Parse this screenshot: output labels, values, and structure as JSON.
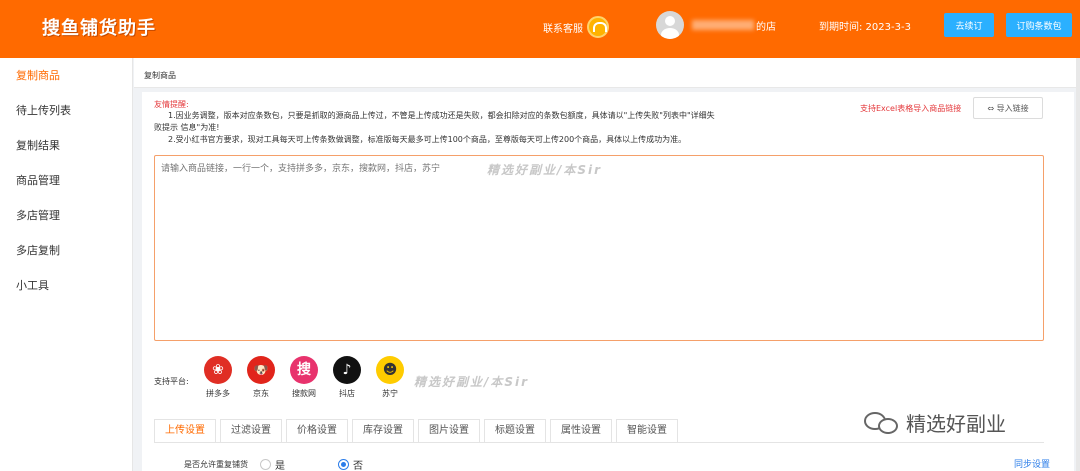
{
  "header": {
    "logo": "搜鱼铺货助手",
    "support_label": "联系客服",
    "shop_suffix": "的店",
    "expire_label": "到期时间: 2023-3-3",
    "renew_label": "去续订",
    "buy_label": "订购条数包"
  },
  "sidebar": {
    "items": [
      {
        "label": "复制商品"
      },
      {
        "label": "待上传列表"
      },
      {
        "label": "复制结果"
      },
      {
        "label": "商品管理"
      },
      {
        "label": "多店管理"
      },
      {
        "label": "多店复制"
      },
      {
        "label": "小工具"
      }
    ]
  },
  "main": {
    "breadcrumb": "复制商品",
    "tip_title": "友情提醒:",
    "tip_1a": "1.因业务调整，版本对应条数包，只要是抓取的源商品上传过，不管是上传成功还是失败，都会扣除对应的条数包额度，具体请以\"上传失败\"列表中\"详细失",
    "tip_1b": "败提示 信息\"为准!",
    "tip_2": "2.受小红书官方要求，现对工具每天可上传条数做调整，标准版每天最多可上传100个商品，至尊版每天可上传200个商品，具体以上传成功为准。",
    "excel_link": "支持Excel表格导入商品链接",
    "import_label": "⇔ 导入链接",
    "textarea_placeholder": "请输入商品链接，一行一个，支持拼多多，京东，搜款网，抖店，苏宁",
    "watermark": "精选好副业/本Sir",
    "platform_label": "支持平台:",
    "platforms": [
      {
        "name": "拼多多",
        "color": "#e02e24",
        "glyph": "❀"
      },
      {
        "name": "京东",
        "color": "#e1251b",
        "glyph": "🐶"
      },
      {
        "name": "搜款网",
        "color": "#e8336d",
        "glyph": "搜"
      },
      {
        "name": "抖店",
        "color": "#111111",
        "glyph": "♪"
      },
      {
        "name": "苏宁",
        "color": "#ffcc00",
        "glyph": "☻"
      }
    ],
    "tabs": [
      "上传设置",
      "过滤设置",
      "价格设置",
      "库存设置",
      "图片设置",
      "标题设置",
      "属性设置",
      "智能设置"
    ],
    "repeat_label": "是否允许重复铺货",
    "radio_yes": "是",
    "radio_no": "否",
    "overflow_link": "同步设置"
  },
  "overlay": {
    "wechat_text": "精选好副业"
  }
}
